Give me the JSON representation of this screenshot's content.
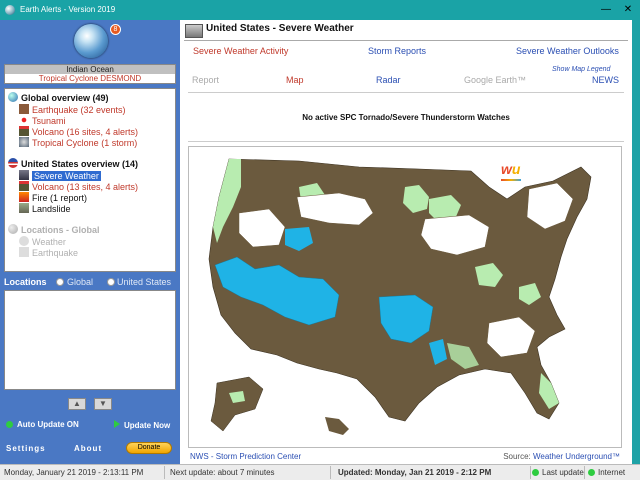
{
  "window": {
    "title": "Earth Alerts - Version 2019",
    "minimize": "—",
    "close": "✕"
  },
  "left": {
    "alert_badge": "8",
    "region": {
      "name": "Indian Ocean",
      "event": "Tropical Cyclone DESMOND"
    },
    "global": {
      "heading": "Global overview (49)",
      "items": [
        {
          "label": "Earthquake (32 events)",
          "icon": "earthquake-icon"
        },
        {
          "label": "Tsunami",
          "icon": "tsunami-icon"
        },
        {
          "label": "Volcano (16 sites, 4 alerts)",
          "icon": "volcano-icon"
        },
        {
          "label": "Tropical Cyclone (1 storm)",
          "icon": "cyclone-icon"
        }
      ]
    },
    "us": {
      "heading": "United States overview (14)",
      "items": [
        {
          "label": "Severe Weather",
          "icon": "severe-weather-icon"
        },
        {
          "label": "Volcano (13 sites, 4 alerts)",
          "icon": "volcano-icon"
        },
        {
          "label": "Fire (1 report)",
          "icon": "fire-icon"
        },
        {
          "label": "Landslide",
          "icon": "landslide-icon"
        }
      ]
    },
    "locations_global": {
      "heading": "Locations - Global",
      "items": [
        {
          "label": "Weather"
        },
        {
          "label": "Earthquake"
        }
      ]
    },
    "locations_bar": {
      "label": "Locations",
      "opt_global": "Global",
      "opt_us": "United States"
    },
    "auto_update": "Auto Update ON",
    "update_now": "Update Now",
    "settings": "Settings",
    "about": "About",
    "donate": "Donate"
  },
  "right": {
    "title": "United States - Severe Weather",
    "tabs_row1": [
      "Severe Weather Activity",
      "Storm Reports",
      "Severe Weather Outlooks"
    ],
    "show_legend": "Show Map Legend",
    "tabs_row2": [
      "Report",
      "Map",
      "Radar",
      "Google Earth™",
      "NEWS"
    ],
    "watch_text": "No active SPC Tornado/Severe Thunderstorm Watches",
    "footer_left": "NWS - Storm Prediction Center",
    "footer_source_label": "Source: ",
    "footer_source": "Weather Underground™",
    "map_colors": {
      "land": "#6b5a3e",
      "watch_blue": "#1fb3e6",
      "light_green": "#b8ecb0",
      "white": "#ffffff"
    }
  },
  "status": {
    "datetime": "Monday, January 21 2019 - 2:13:11 PM",
    "next_update": "Next update: about 7 minutes",
    "updated": "Updated: Monday, Jan 21 2019 - 2:12 PM",
    "last_update": "Last update",
    "internet": "Internet"
  }
}
